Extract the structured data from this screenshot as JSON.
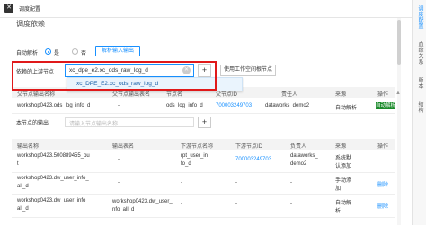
{
  "window": {
    "title": "调度配置"
  },
  "right_tabs": [
    "调度配置",
    "血缘关系",
    "版本",
    "结构"
  ],
  "section": {
    "title": "调度依赖"
  },
  "auto_parse": {
    "label": "自动解析",
    "yes": "是",
    "no": "否",
    "button": "解析输入输出"
  },
  "upstream": {
    "label": "依赖的上游节点",
    "input_value": "xc_dpe_e2.xc_ods_raw_log_d",
    "plus": "+",
    "workspace_button": "使用工作空间根节点",
    "dropdown_option": "xc_DPE_E2.xc_ods_raw_log_d"
  },
  "table1": {
    "headers": [
      "父节点输出名称",
      "父节点输出表名",
      "节点名",
      "父节点ID",
      "责任人",
      "来源",
      "操作"
    ],
    "rows": [
      {
        "output_name": "workshop0423.ods_log_info_d",
        "output_table": "-",
        "node_name": "ods_log_info_d",
        "node_id": "700003249703",
        "owner": "dataworks_demo2",
        "source": "自动解析"
      }
    ]
  },
  "node_output": {
    "label": "本节点的输出",
    "placeholder": "请输入节点输出名称",
    "plus": "+"
  },
  "table2": {
    "headers": [
      "输出名称",
      "输出表名",
      "下游节点名称",
      "下游节点ID",
      "负责人",
      "来源",
      "操作"
    ],
    "rows": [
      {
        "output_name": [
          "workshop0423.500889455_ou",
          "t"
        ],
        "output_table": "-",
        "downstream_name": [
          "rpt_user_in",
          "fo_d"
        ],
        "downstream_id": "700003249703",
        "owner": [
          "dataworks_",
          "demo2"
        ],
        "source": [
          "系统默",
          "认添加"
        ],
        "op": ""
      },
      {
        "output_name": [
          "workshop0423.dw_user_info_",
          "all_d"
        ],
        "output_table": "-",
        "downstream_name": [
          "-"
        ],
        "downstream_id": "-",
        "owner": [
          "-"
        ],
        "source": [
          "手动添",
          "加"
        ],
        "op": "删除"
      },
      {
        "output_name": [
          "workshop0423.dw_user_info_",
          "all_d"
        ],
        "output_table": "workshop0423.dw_user_i nfo_all_d",
        "downstream_name": [
          "-"
        ],
        "downstream_id": "-",
        "owner": [
          "-"
        ],
        "source": [
          "自动解",
          "析"
        ],
        "op": "删除"
      }
    ]
  }
}
